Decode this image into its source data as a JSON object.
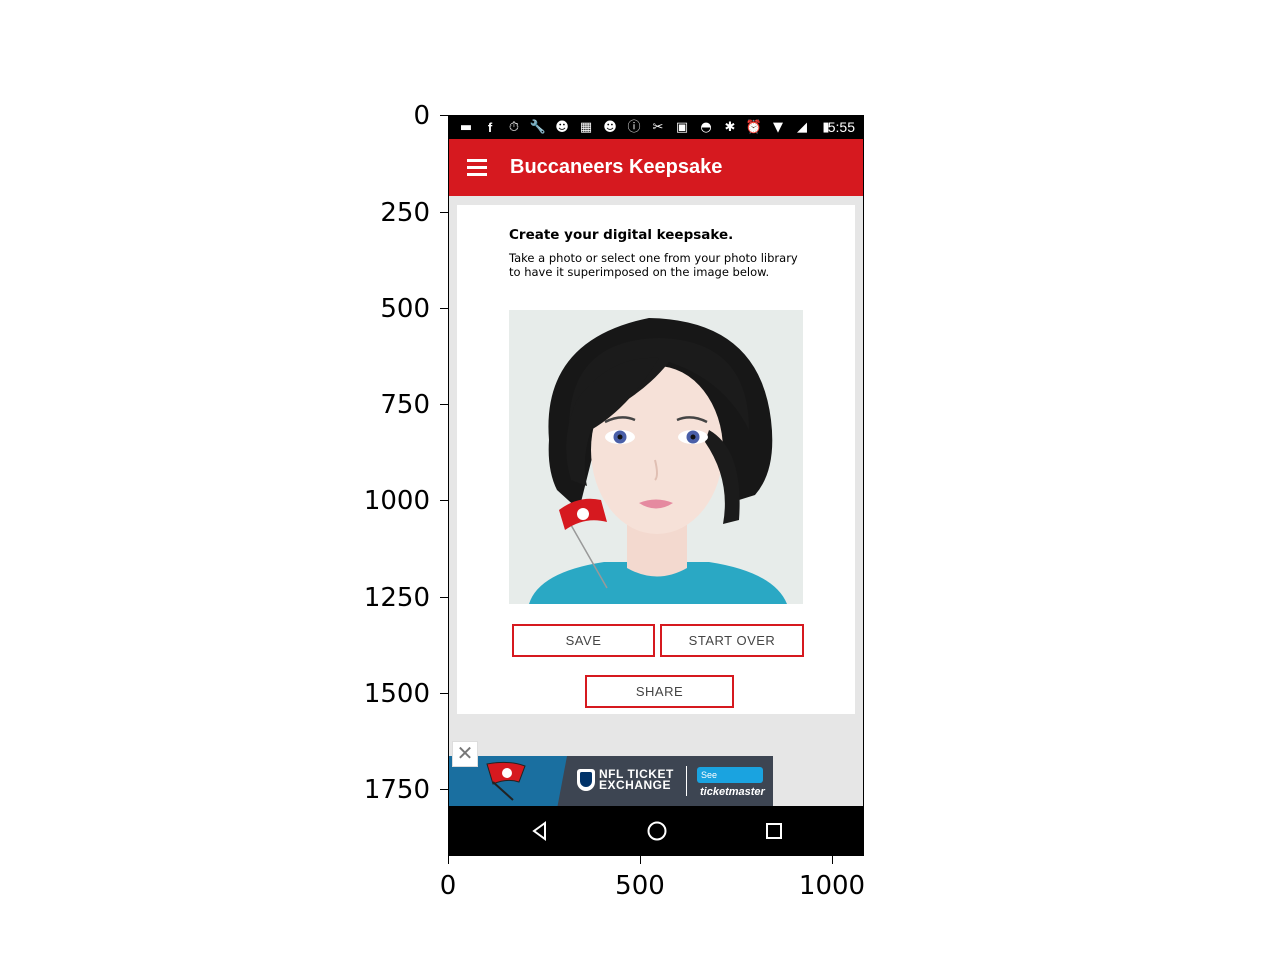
{
  "plot": {
    "y_ticks": [
      "0",
      "250",
      "500",
      "750",
      "1000",
      "1250",
      "1500",
      "1750"
    ],
    "x_ticks": [
      "0",
      "500",
      "1000"
    ]
  },
  "status_bar": {
    "time": "5:55",
    "icons": [
      "chat-icon",
      "facebook-icon",
      "timer-icon",
      "wrench-icon",
      "smiley-icon",
      "image-icon",
      "smiley-icon",
      "info-icon",
      "tools-icon",
      "lock-icon",
      "android-icon",
      "bluetooth-icon",
      "alarm-icon",
      "wifi-icon",
      "no-signal-icon",
      "battery-icon"
    ]
  },
  "app_bar": {
    "title": "Buccaneers Keepsake",
    "menu_icon": "hamburger-menu-icon",
    "color": "#d6191f"
  },
  "card": {
    "heading": "Create your digital keepsake.",
    "description": "Take a photo or select one from your photo library to have it superimposed on the image below."
  },
  "buttons": {
    "save": "SAVE",
    "start_over": "START OVER",
    "share": "SHARE"
  },
  "ad": {
    "line1": "NFL TICKET",
    "line2": "EXCHANGE",
    "see_label": "See",
    "brand": "ticketmaster",
    "close_glyph": "✕"
  },
  "nav_bar": {
    "icons": [
      "back-icon",
      "home-icon",
      "recents-icon"
    ]
  }
}
